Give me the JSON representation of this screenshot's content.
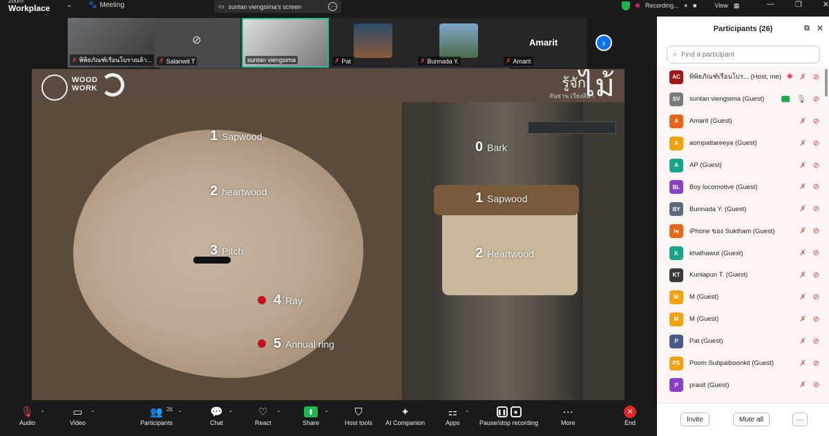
{
  "topbar": {
    "brand_small": "zoom",
    "brand": "Workplace",
    "meeting": "Meeting",
    "screen_share": "suntan viengsima's screen",
    "recording": "Recording...",
    "view": "View"
  },
  "thumbnails": [
    {
      "name": "พิพิธภัณฑ์เรือนโบราณล้า..."
    },
    {
      "name": "Salanwit T"
    },
    {
      "name": "suntan viengsima"
    },
    {
      "name": "Pat"
    },
    {
      "name": "Bunnada Y."
    },
    {
      "name": "Amarit",
      "display": "Amarit"
    }
  ],
  "slide": {
    "logo_text_1": "WOOD",
    "logo_text_2": "WORK",
    "title_th": "รู้จัก",
    "subtitle_th": "สันธาน เวียงสิมา",
    "big_th": "ไม้",
    "labels_left": [
      {
        "num": "1",
        "text": "Sapwood"
      },
      {
        "num": "2",
        "text": "heartwood"
      },
      {
        "num": "3",
        "text": "Pitch"
      },
      {
        "num": "4",
        "text": "Ray"
      },
      {
        "num": "5",
        "text": "Annual ring"
      }
    ],
    "labels_right": [
      {
        "num": "0",
        "text": "Bark"
      },
      {
        "num": "1",
        "text": "Sapwood"
      },
      {
        "num": "2",
        "text": "Heartwood"
      }
    ]
  },
  "participants": {
    "title": "Participants (26)",
    "search_placeholder": "Find a participant",
    "list": [
      {
        "name": "พิพิธภัณฑ์เรือนโบร...",
        "role": "(Host, me)",
        "initials": "AC",
        "color": "#a01818"
      },
      {
        "name": "suntan viengsima",
        "role": "(Guest)",
        "initials": "SV",
        "color": "#7b7b7b"
      },
      {
        "name": "Amarit",
        "role": "(Guest)",
        "initials": "A",
        "color": "#e8661a"
      },
      {
        "name": "aompattareeya",
        "role": "(Guest)",
        "initials": "A",
        "color": "#f2a20c"
      },
      {
        "name": "AP",
        "role": "(Guest)",
        "initials": "A",
        "color": "#1aa58a"
      },
      {
        "name": "Boy locomotive",
        "role": "(Guest)",
        "initials": "BL",
        "color": "#8a3fc7"
      },
      {
        "name": "Bunnada Y.",
        "role": "(Guest)",
        "initials": "BY",
        "color": "#5a6b7d"
      },
      {
        "name": "iPhone ของ Suktham",
        "role": "(Guest)",
        "initials": "iข",
        "color": "#e8661a"
      },
      {
        "name": "khathawut",
        "role": "(Guest)",
        "initials": "K",
        "color": "#1aa58a"
      },
      {
        "name": "Kunlapun T.",
        "role": "(Guest)",
        "initials": "KT",
        "color": "#3a3a3a"
      },
      {
        "name": "M",
        "role": "(Guest)",
        "initials": "M",
        "color": "#f2a20c"
      },
      {
        "name": "M",
        "role": "(Guest)",
        "initials": "M",
        "color": "#f2a20c"
      },
      {
        "name": "Pat",
        "role": "(Guest)",
        "initials": "P",
        "color": "#4a5b8a"
      },
      {
        "name": "Poom Subpaiboonkit",
        "role": "(Guest)",
        "initials": "PS",
        "color": "#f2a20c"
      },
      {
        "name": "prasit",
        "role": "(Guest)",
        "initials": "P",
        "color": "#8a3fc7"
      }
    ],
    "invite": "Invite",
    "mute_all": "Mute all",
    "more": "···"
  },
  "toolbar": {
    "audio": "Audio",
    "video": "Video",
    "participants": "Participants",
    "participants_count": "26",
    "chat": "Chat",
    "react": "React",
    "share": "Share",
    "host_tools": "Host tools",
    "ai_companion": "AI Companion",
    "apps": "Apps",
    "pause_stop": "Pause/stop recording",
    "more": "More",
    "end": "End"
  },
  "colors": {
    "accent_blue": "#0e71eb",
    "green_share": "#21b64c",
    "end_red": "#e02828",
    "muted_red": "#e04a4a",
    "active_thumb_border": "#22c08a"
  }
}
